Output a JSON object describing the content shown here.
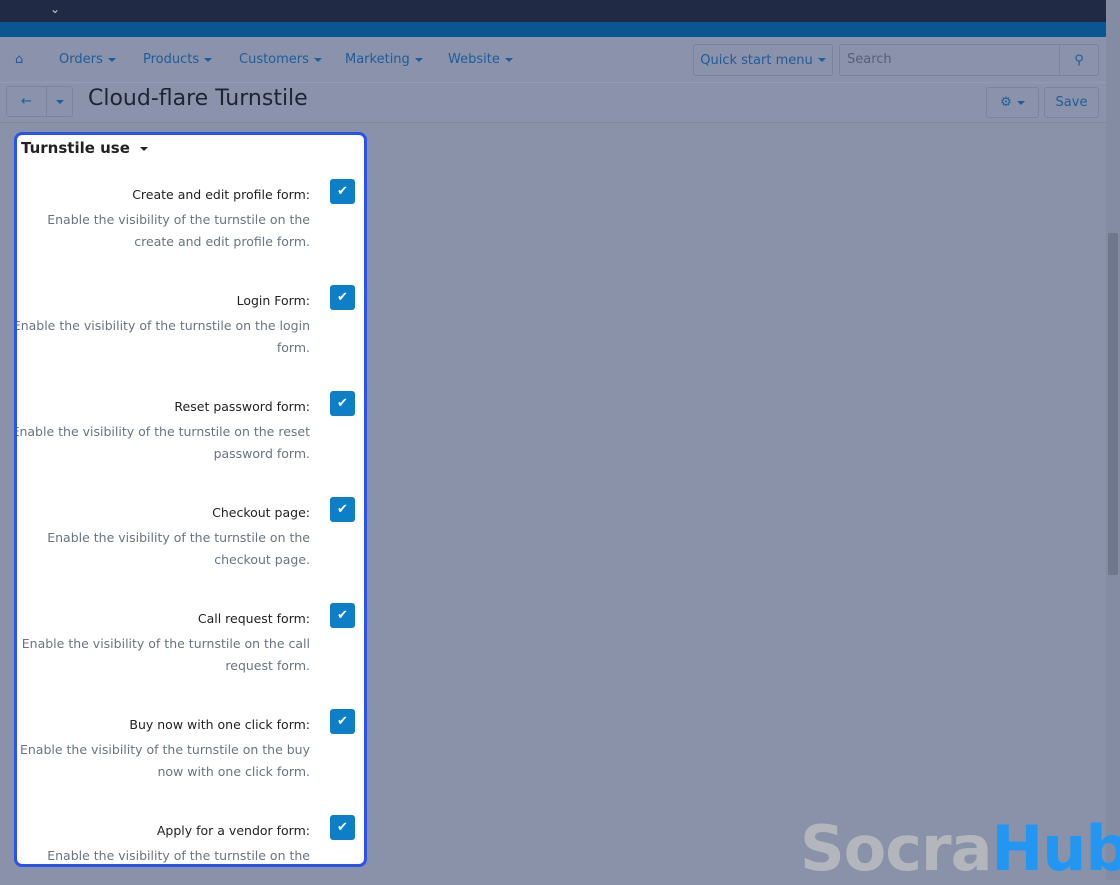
{
  "nav": {
    "items": [
      "Orders",
      "Products",
      "Customers",
      "Marketing",
      "Website"
    ],
    "quick_start": "Quick start menu",
    "search_placeholder": "Search"
  },
  "page": {
    "title": "Cloud-flare Turnstile",
    "save": "Save"
  },
  "section": {
    "title": "Turnstile use",
    "items": [
      {
        "label": "Create and edit profile form:",
        "desc": "Enable the visibility of the turnstile on the create and edit profile form.",
        "checked": true
      },
      {
        "label": "Login Form:",
        "desc": "Enable the visibility of the turnstile on the login form.",
        "checked": true
      },
      {
        "label": "Reset password form:",
        "desc": "Enable the visibility of the turnstile on the reset password form.",
        "checked": true
      },
      {
        "label": "Checkout page:",
        "desc": "Enable the visibility of the turnstile on the checkout page.",
        "checked": true
      },
      {
        "label": "Call request form:",
        "desc": "Enable the visibility of the turnstile on the call request form.",
        "checked": true
      },
      {
        "label": "Buy now with one click form:",
        "desc": "Enable the visibility of the turnstile on the buy now with one click form.",
        "checked": true
      },
      {
        "label": "Apply for a vendor form:",
        "desc": "Enable the visibility of the turnstile on the apply for a vendor form.",
        "checked": true
      }
    ]
  },
  "watermark": {
    "part1": "Socra",
    "part2": "Hub"
  }
}
